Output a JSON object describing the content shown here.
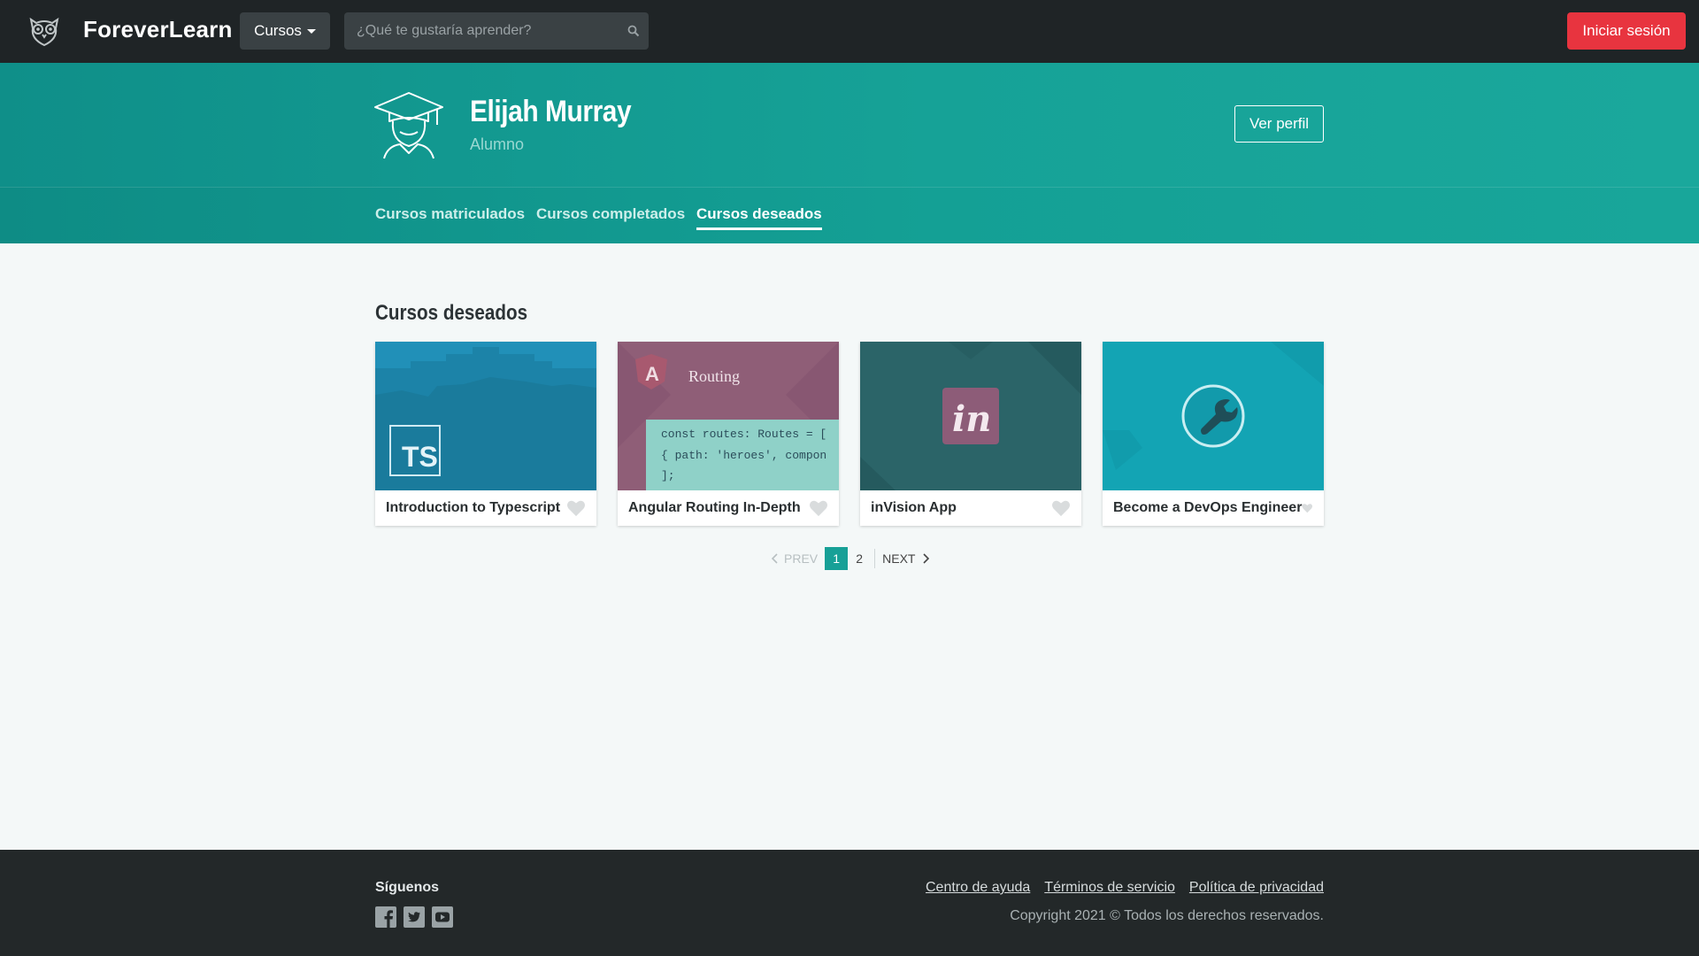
{
  "navbar": {
    "logo_icon": "owl-icon",
    "brand": "ForeverLearn",
    "courses_menu_label": "Cursos",
    "search_placeholder": "¿Qué te gustaría aprender?",
    "login_label": "Iniciar sesión"
  },
  "profile": {
    "avatar_icon": "graduate-avatar-icon",
    "name": "Elijah Murray",
    "role": "Alumno",
    "view_profile_label": "Ver perfil"
  },
  "tabs": [
    {
      "label": "Cursos matriculados",
      "active": false
    },
    {
      "label": "Cursos completados",
      "active": false
    },
    {
      "label": "Cursos deseados",
      "active": true
    }
  ],
  "main": {
    "section_title": "Cursos deseados",
    "courses": [
      {
        "title": "Introduction to Typescript",
        "thumb_color": "#2190b8",
        "thumb_label": "TS",
        "favorited": false
      },
      {
        "title": "Angular Routing In-Depth",
        "thumb_color": "#8f5e77",
        "thumb_label": "Routing",
        "code_lines": [
          "const routes: Routes = [",
          "  { path: 'heroes', compon",
          "];"
        ],
        "favorited": false
      },
      {
        "title": "inVision App",
        "thumb_color": "#2b6468",
        "thumb_label": "in",
        "favorited": false
      },
      {
        "title": "Become a DevOps Engineer",
        "thumb_color": "#13a4b4",
        "thumb_label": "wrench-icon",
        "favorited": false
      }
    ]
  },
  "pagination": {
    "prev_label": "PREV",
    "pages": [
      "1",
      "2"
    ],
    "current_page": "1",
    "next_label": "NEXT"
  },
  "footer": {
    "follow_label": "Síguenos",
    "social": [
      "facebook-icon",
      "twitter-icon",
      "youtube-icon"
    ],
    "links": [
      "Centro de ayuda",
      "Términos de servicio",
      "Política de privacidad"
    ],
    "copyright": "Copyright 2021 © Todos los derechos reservados."
  },
  "colors": {
    "navbar_bg": "#1f2426",
    "accent_teal": "#17a097",
    "login_red": "#e8343f",
    "footer_bg": "#232829"
  }
}
